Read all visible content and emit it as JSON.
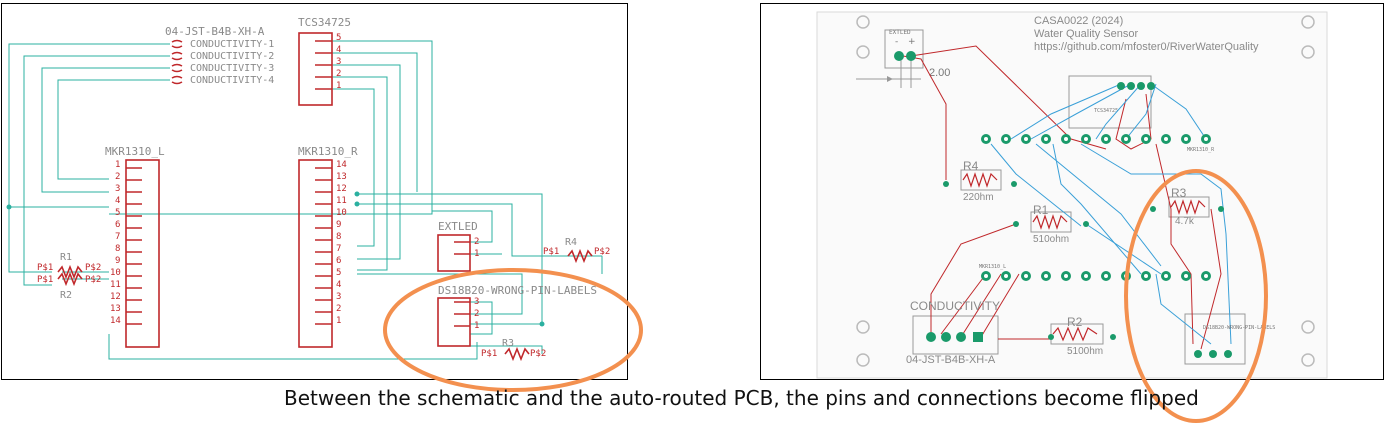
{
  "schematic": {
    "jst": {
      "name": "04-JST-B4B-XH-A",
      "pins": [
        "CONDUCTIVITY-1",
        "CONDUCTIVITY-2",
        "CONDUCTIVITY-3",
        "CONDUCTIVITY-4"
      ]
    },
    "tcs": {
      "name": "TCS34725",
      "pins": [
        "5",
        "4",
        "3",
        "2",
        "1"
      ]
    },
    "mkr_l": {
      "name": "MKR1310_L",
      "pins": [
        "1",
        "2",
        "3",
        "4",
        "5",
        "6",
        "7",
        "8",
        "9",
        "10",
        "11",
        "12",
        "13",
        "14"
      ]
    },
    "mkr_r": {
      "name": "MKR1310_R",
      "pins": [
        "14",
        "13",
        "12",
        "11",
        "10",
        "9",
        "8",
        "7",
        "6",
        "5",
        "4",
        "3",
        "2",
        "1"
      ]
    },
    "extled": {
      "name": "EXTLED",
      "pins": [
        "2",
        "1"
      ]
    },
    "ds18b20": {
      "name": "DS18B20-WRONG-PIN-LABELS",
      "pins": [
        "3",
        "2",
        "1"
      ]
    },
    "r1": {
      "name": "R1",
      "p1": "P$1",
      "p2": "P$2"
    },
    "r2": {
      "name": "R2",
      "p1": "P$1",
      "p2": "P$2"
    },
    "r3": {
      "name": "R3",
      "p1": "P$1",
      "p2": "P$2"
    },
    "r4": {
      "name": "R4",
      "p1": "P$1",
      "p2": "P$2"
    }
  },
  "pcb": {
    "title_lines": [
      "CASA0022 (2024)",
      "Water Quality Sensor",
      "https://github.com/mfoster0/RiverWaterQuality"
    ],
    "extled_label": "EXTLED",
    "dimension": "2.00",
    "tcs_label": "TCS34725",
    "mkr_r_label": "MKR1310_R",
    "mkr_l_label": "MKR1310_L",
    "r4": {
      "name": "R4",
      "value": "220hm"
    },
    "r1": {
      "name": "R1",
      "value": "510ohm"
    },
    "r3": {
      "name": "R3",
      "value": "4.7k"
    },
    "r2": {
      "name": "R2",
      "value": "5100hm"
    },
    "conductivity_label": "CONDUCTIVITY",
    "jst_label": "04-JST-B4B-XH-A",
    "ds_label": "DS18B20-WRONG-PIN-LABELS",
    "extled_pins": [
      "-",
      "+"
    ]
  },
  "caption": "Between the schematic and the auto-routed PCB, the pins and connections become flipped",
  "colors": {
    "net": "#2bb0a0",
    "part": "#c0282b",
    "label": "#8a8a8a",
    "copper_top": "#c0282b",
    "copper_bottom": "#3aa0d8",
    "pad": "#1a9a6a",
    "highlight": "#f3904f"
  }
}
